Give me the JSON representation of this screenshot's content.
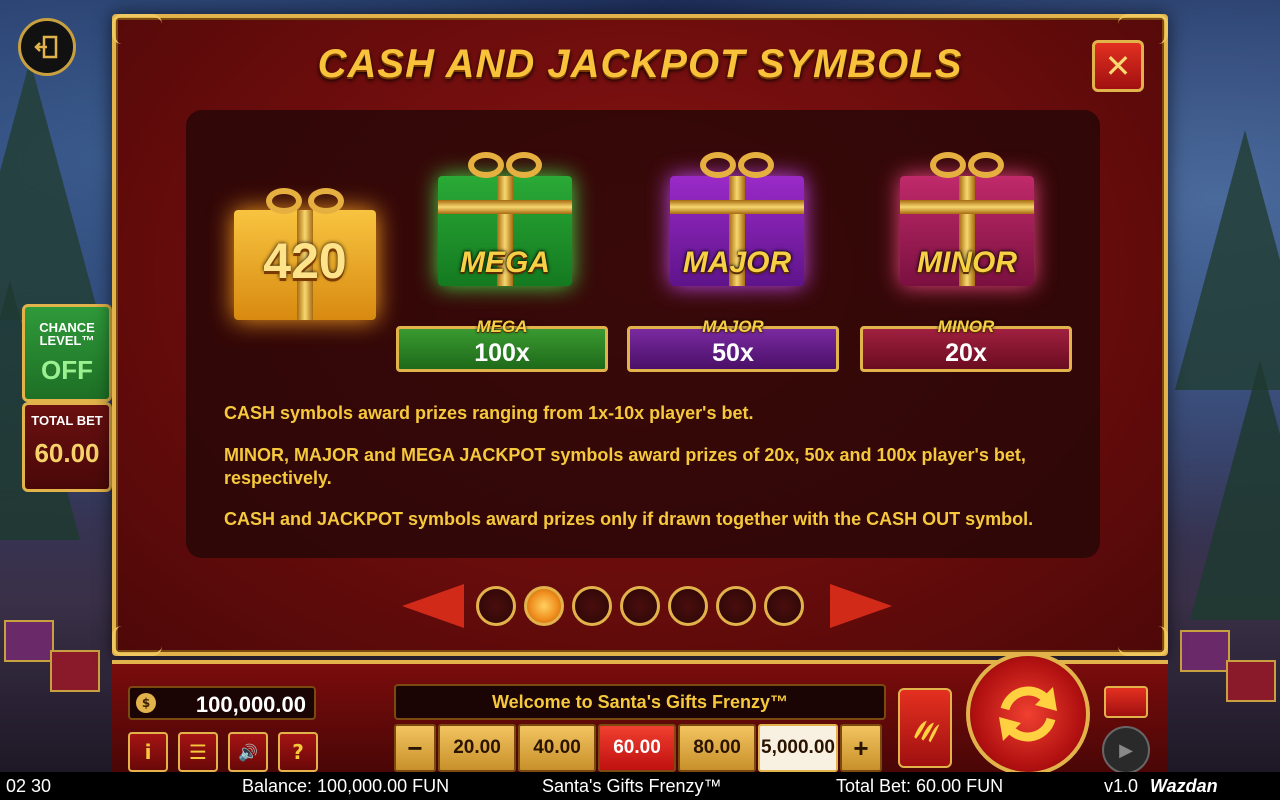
{
  "game": {
    "title": "Santa's Gifts Frenzy™"
  },
  "panel": {
    "title": "CASH AND JACKPOT SYMBOLS",
    "close_symbol": "✕"
  },
  "symbols": {
    "cash": {
      "value": "420",
      "color": "#e8a420"
    },
    "jackpots": [
      {
        "word": "MEGA",
        "plaque_name": "MEGA",
        "multiplier": "100x",
        "box_color": "#1e8a2a",
        "plaque_color": "#2a7a24"
      },
      {
        "word": "MAJOR",
        "plaque_name": "MAJOR",
        "multiplier": "50x",
        "box_color": "#7a1ea0",
        "plaque_color": "#5a1a78"
      },
      {
        "word": "MINOR",
        "plaque_name": "MINOR",
        "multiplier": "20x",
        "box_color": "#a0205a",
        "plaque_color": "#7a1030"
      }
    ]
  },
  "description": [
    "CASH symbols award prizes ranging from 1x-10x player's bet.",
    "MINOR, MAJOR and MEGA JACKPOT symbols award prizes of 20x, 50x and 100x player's bet, respectively.",
    "CASH and JACKPOT symbols award prizes only if drawn together with the CASH OUT symbol."
  ],
  "pager": {
    "total_pages": 7,
    "active_index": 1
  },
  "side": {
    "chance_label_1": "CHANCE",
    "chance_label_2": "LEVEL™",
    "chance_value": "OFF",
    "total_bet_label": "TOTAL BET",
    "total_bet_value": "60.00"
  },
  "bottom": {
    "balance": "100,000.00",
    "money_icon": "$",
    "welcome_message": "Welcome to Santa's Gifts Frenzy™",
    "bet_minus": "−",
    "bet_plus": "+",
    "bet_options": [
      "20.00",
      "40.00",
      "60.00",
      "80.00",
      "5,000.00"
    ],
    "selected_bet": "60.00",
    "buttons": {
      "info": "i",
      "menu": "☰",
      "sound": "🔊",
      "help": "?"
    }
  },
  "status_bar": {
    "time": "02 30",
    "balance": "Balance: 100,000.00 FUN",
    "game_name": "Santa's Gifts Frenzy™",
    "total_bet": "Total Bet: 60.00 FUN",
    "version": "v1.0",
    "brand": "Wazdan"
  },
  "icons": {
    "exit": "exit-icon",
    "close": "close-icon",
    "spin": "spin-arrows-icon",
    "turbo": "chili-icon",
    "autoplay": "play-icon"
  }
}
